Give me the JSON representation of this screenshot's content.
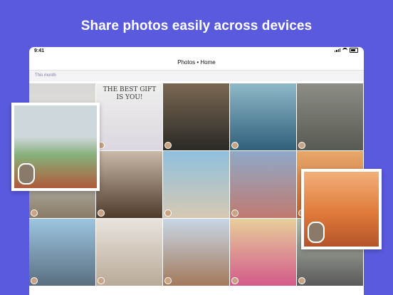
{
  "headline": "Share photos easily across devices",
  "status": {
    "time": "9:41"
  },
  "nav": {
    "title": "Photos • Home"
  },
  "section": {
    "label": "This month"
  },
  "photos": [
    {
      "name": "photo-wall",
      "col": 0,
      "row": 0,
      "colors": [
        "#d8d6d2",
        "#eceae6"
      ]
    },
    {
      "name": "photo-the-best-gift",
      "col": 1,
      "row": 0,
      "caption": "THE BEST GIFT IS YOU!",
      "colors": [
        "#f0f0ee",
        "#dcd6e0"
      ]
    },
    {
      "name": "photo-zebra",
      "col": 2,
      "row": 0,
      "colors": [
        "#7a6752",
        "#2a2a26"
      ]
    },
    {
      "name": "photo-aquarium-kids",
      "col": 3,
      "row": 0,
      "colors": [
        "#8fb9c8",
        "#2f5f7a"
      ]
    },
    {
      "name": "photo-elephant",
      "col": 4,
      "row": 0,
      "colors": [
        "#8d8d86",
        "#575a52"
      ]
    },
    {
      "name": "photo-meadow-boy",
      "col": 0,
      "row": 1,
      "colors": [
        "#cfd7dd",
        "#8a7b66"
      ]
    },
    {
      "name": "photo-campfire-smores",
      "col": 1,
      "row": 1,
      "colors": [
        "#c9b9a8",
        "#4f3a2a"
      ]
    },
    {
      "name": "photo-beach",
      "col": 2,
      "row": 1,
      "colors": [
        "#8fc0de",
        "#d6c9b2"
      ]
    },
    {
      "name": "photo-pier-sunset-sky",
      "col": 3,
      "row": 1,
      "colors": [
        "#8fa9c9",
        "#c07a70"
      ]
    },
    {
      "name": "photo-sunset-water",
      "col": 4,
      "row": 1,
      "colors": [
        "#e8a86a",
        "#c2612e"
      ]
    },
    {
      "name": "photo-dock-kids",
      "col": 0,
      "row": 2,
      "colors": [
        "#9cc5e0",
        "#5a6f80"
      ]
    },
    {
      "name": "photo-smore-hand",
      "col": 1,
      "row": 2,
      "colors": [
        "#e9e4dd",
        "#b9aa98"
      ]
    },
    {
      "name": "photo-sunglasses-selfie",
      "col": 2,
      "row": 2,
      "colors": [
        "#c8d7e6",
        "#a37a5c"
      ]
    },
    {
      "name": "photo-pink-selfie",
      "col": 3,
      "row": 2,
      "colors": [
        "#e7cf9a",
        "#d45a8a"
      ]
    },
    {
      "name": "photo-stroller",
      "col": 4,
      "row": 2,
      "colors": [
        "#b9c2b0",
        "#5a5a5a"
      ]
    }
  ],
  "cards": [
    {
      "name": "floating-card-meadow",
      "colors": [
        "#cfd8dc",
        "#86b07a",
        "#b05a3a"
      ]
    },
    {
      "name": "floating-card-sunset",
      "colors": [
        "#f2b07a",
        "#e07a3a",
        "#b4542a"
      ]
    }
  ]
}
